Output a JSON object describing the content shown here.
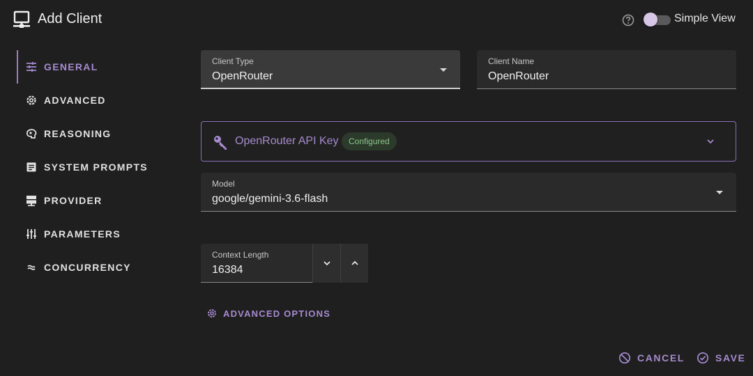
{
  "header": {
    "title": "Add Client",
    "toggle_label": "Simple View",
    "simple_view_on": false
  },
  "sidebar": {
    "items": [
      {
        "label": "General",
        "icon": "sliders-icon",
        "active": true
      },
      {
        "label": "Advanced",
        "icon": "gear-icon",
        "active": false
      },
      {
        "label": "Reasoning",
        "icon": "brain-icon",
        "active": false
      },
      {
        "label": "System Prompts",
        "icon": "document-icon",
        "active": false
      },
      {
        "label": "Provider",
        "icon": "server-icon",
        "active": false
      },
      {
        "label": "Parameters",
        "icon": "tune-icon",
        "active": false
      },
      {
        "label": "Concurrency",
        "icon": "approx-icon",
        "active": false
      }
    ]
  },
  "form": {
    "client_type": {
      "label": "Client Type",
      "value": "OpenRouter"
    },
    "client_name": {
      "label": "Client Name",
      "value": "OpenRouter"
    },
    "api_key": {
      "label": "OpenRouter API Key",
      "status": "Configured"
    },
    "model": {
      "label": "Model",
      "value": "google/gemini-3.6-flash"
    },
    "context_length": {
      "label": "Context Length",
      "value": "16384"
    },
    "advanced_options_label": "Advanced Options"
  },
  "actions": {
    "cancel_label": "Cancel",
    "save_label": "Save"
  },
  "colors": {
    "accent": "#a68bd0",
    "background": "#1f1f1f",
    "badge_text": "#8bc48b"
  }
}
